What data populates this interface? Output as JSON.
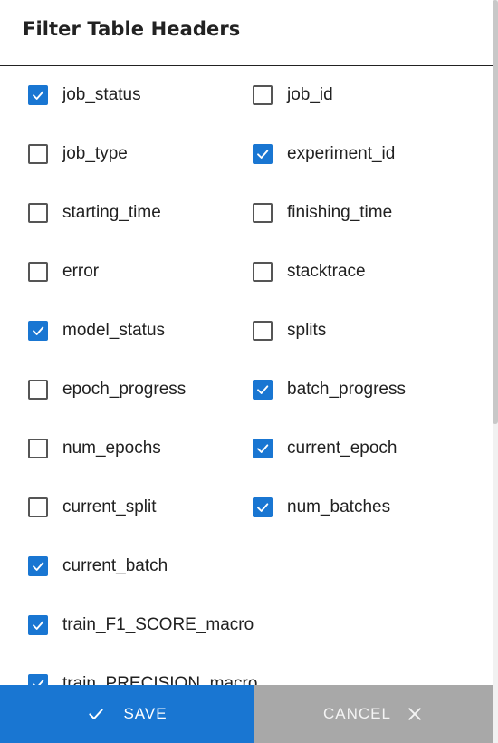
{
  "dialog": {
    "title": "Filter Table Headers"
  },
  "left_column": [
    {
      "label": "job_status",
      "checked": true
    },
    {
      "label": "job_type",
      "checked": false
    },
    {
      "label": "starting_time",
      "checked": false
    },
    {
      "label": "error",
      "checked": false
    },
    {
      "label": "model_status",
      "checked": true
    },
    {
      "label": "epoch_progress",
      "checked": false
    },
    {
      "label": "num_epochs",
      "checked": false
    },
    {
      "label": "current_split",
      "checked": false
    },
    {
      "label": "current_batch",
      "checked": true
    },
    {
      "label": "train_F1_SCORE_macro",
      "checked": true
    },
    {
      "label": "train_PRECISION_macro",
      "checked": true
    }
  ],
  "right_column": [
    {
      "label": "job_id",
      "checked": false
    },
    {
      "label": "experiment_id",
      "checked": true
    },
    {
      "label": "finishing_time",
      "checked": false
    },
    {
      "label": "stacktrace",
      "checked": false
    },
    {
      "label": "splits",
      "checked": false
    },
    {
      "label": "batch_progress",
      "checked": true
    },
    {
      "label": "current_epoch",
      "checked": true
    },
    {
      "label": "num_batches",
      "checked": true
    }
  ],
  "footer": {
    "save_label": "SAVE",
    "cancel_label": "CANCEL"
  },
  "colors": {
    "accent": "#1976d2",
    "cancel_bg": "#a8a8a8"
  }
}
